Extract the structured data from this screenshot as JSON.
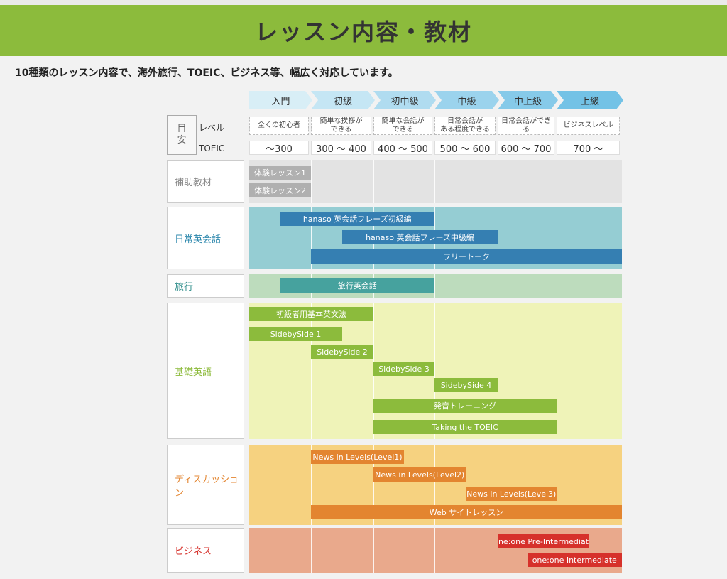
{
  "title": "レッスン内容・教材",
  "intro": "10種類のレッスン内容で、海外旅行、TOEIC、ビジネス等、幅広く対応しています。",
  "meyasu": [
    "目",
    "安"
  ],
  "row_labels": {
    "level": "レベル",
    "toeic": "TOEIC"
  },
  "levels": [
    "入門",
    "初級",
    "初中級",
    "中級",
    "中上級",
    "上級"
  ],
  "level_colors": [
    "#d8eef6",
    "#c5e6f4",
    "#b0dcf0",
    "#9bd3ed",
    "#86cae9",
    "#73c2e6"
  ],
  "level_descriptions": [
    [
      "全くの初心者"
    ],
    [
      "簡単な挨拶が",
      "できる"
    ],
    [
      "簡単な会話が",
      "できる"
    ],
    [
      "日常会話が",
      "ある程度できる"
    ],
    [
      "日常会話ができる"
    ],
    [
      "ビジネスレベル"
    ]
  ],
  "toeic": [
    "～300",
    "300 ～ 400",
    "400 ～ 500",
    "500 ～ 600",
    "600 ～ 700",
    "700 ～"
  ],
  "categories": [
    {
      "name": "補助教材",
      "label_color": "#888888",
      "band_color": "#e3e3e3",
      "bar_color": "#b0b0b0",
      "materials": [
        "体験レッスン1",
        "体験レッスン2"
      ]
    },
    {
      "name": "日常英会話",
      "label_color": "#2e88ad",
      "band_color": "#95cdd3",
      "bar_color": "#357fb2",
      "materials": [
        "hanaso 英会話フレーズ初級編",
        "hanaso 英会話フレーズ中級編",
        "フリートーク"
      ]
    },
    {
      "name": "旅行",
      "label_color": "#2e8d8a",
      "band_color": "#bddcbd",
      "bar_color": "#46a29e",
      "materials": [
        "旅行英会話"
      ]
    },
    {
      "name": "基礎英語",
      "label_color": "#8cba3a",
      "band_color": "#eff3b8",
      "bar_color": "#8cbb3c",
      "materials": [
        "初級者用基本英文法",
        "SidebySide 1",
        "SidebySide 2",
        "SidebySide 3",
        "SidebySide 4",
        "発音トレーニング",
        "Taking the TOEIC"
      ]
    },
    {
      "name": "ディスカッション",
      "label_color": "#e38530",
      "band_color": "#f6d280",
      "bar_color": "#e38530",
      "materials": [
        "News in Levels(Level1)",
        "News in Levels(Level2)",
        "News in Levels(Level3)",
        "Web サイトレッスン"
      ]
    },
    {
      "name": "ビジネス",
      "label_color": "#d6312b",
      "band_color": "#e9a98c",
      "bar_color": "#d6312b",
      "materials": [
        "one:one Pre-Intermediate",
        "one:one Intermediate"
      ]
    }
  ],
  "coverage": [
    [
      [
        1,
        1
      ],
      [
        1,
        1
      ]
    ],
    [
      [
        1.5,
        3
      ],
      [
        2.5,
        4
      ],
      [
        2,
        6
      ]
    ],
    [
      [
        1.5,
        3
      ]
    ],
    [
      [
        1,
        2
      ],
      [
        1,
        1.5
      ],
      [
        2,
        2
      ],
      [
        3,
        3
      ],
      [
        4,
        4
      ],
      [
        3,
        5
      ],
      [
        3,
        5
      ]
    ],
    [
      [
        2,
        2.5
      ],
      [
        3,
        3.5
      ],
      [
        4.5,
        5
      ],
      [
        2,
        6
      ]
    ],
    [
      [
        5,
        5.5
      ],
      [
        5.5,
        6
      ]
    ]
  ]
}
